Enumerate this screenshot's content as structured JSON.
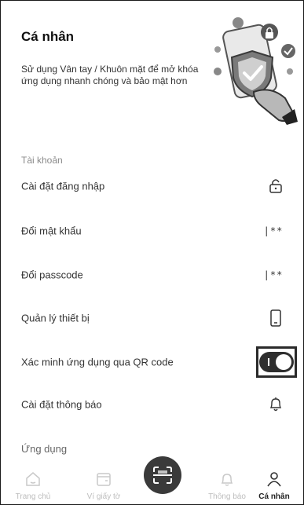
{
  "header": {
    "title": "Cá nhân",
    "subtitle": "Sử dụng Vân tay / Khuôn mặt để mở khóa ứng dụng nhanh chóng và bảo mật hơn"
  },
  "sections": {
    "account_label": "Tài khoản",
    "apps_label": "Ứng dụng"
  },
  "settings": [
    {
      "label": "Cài đặt đăng nhập",
      "icon": "lock-icon"
    },
    {
      "label": "Đổi mật khẩu",
      "icon": "password-mask-icon",
      "mask": "|**"
    },
    {
      "label": "Đổi passcode",
      "icon": "passcode-mask-icon",
      "mask": "|**"
    },
    {
      "label": "Quản lý thiết bị",
      "icon": "phone-icon"
    },
    {
      "label": "Xác minh ứng dụng qua QR code",
      "icon": "toggle",
      "toggle_on": true
    },
    {
      "label": "Cài đặt thông báo",
      "icon": "bell-icon"
    }
  ],
  "bottom_nav": {
    "items": [
      {
        "label": "Trang chủ",
        "icon": "home-icon",
        "active": false
      },
      {
        "label": "Ví giấy tờ",
        "icon": "wallet-icon",
        "active": false
      },
      {
        "label": "Thông báo",
        "icon": "bell-icon",
        "active": false
      },
      {
        "label": "Cá nhân",
        "icon": "user-icon",
        "active": true
      }
    ],
    "scan_icon": "scan-icon"
  },
  "colors": {
    "toggle_on": "#2e2e2e",
    "inactive_nav": "#bdbdbd",
    "active_nav": "#222222"
  }
}
